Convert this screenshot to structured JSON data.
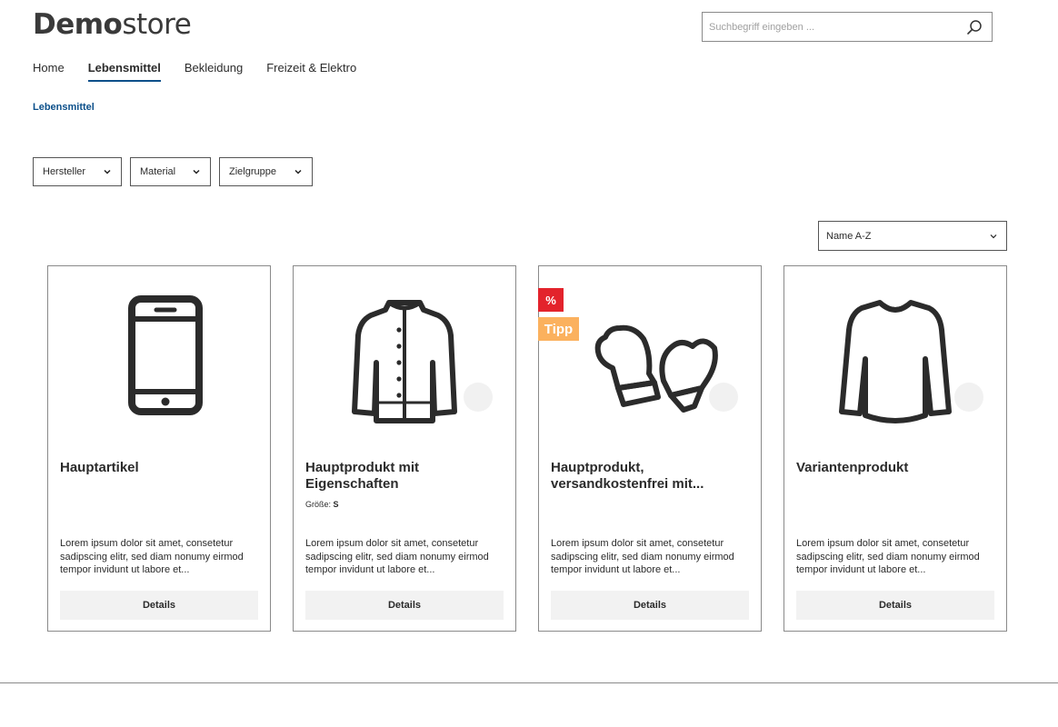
{
  "header": {
    "logo_bold": "Demo",
    "logo_light": "store",
    "search": {
      "placeholder": "Suchbegriff eingeben ..."
    }
  },
  "nav": {
    "items": [
      "Home",
      "Lebensmittel",
      "Bekleidung",
      "Freizeit & Elektro"
    ],
    "active": "Lebensmittel"
  },
  "breadcrumb": "Lebensmittel",
  "filters": [
    "Hersteller",
    "Material",
    "Zielgruppe"
  ],
  "sort": {
    "selected": "Name A-Z"
  },
  "products": [
    {
      "title": "Hauptartikel",
      "image": "smartphone-icon",
      "property_label": "",
      "property_value": "",
      "description": "Lorem ipsum dolor sit amet, consetetur sadipscing elitr, sed diam nonumy eirmod tempor invidunt ut labore et...",
      "button": "Details"
    },
    {
      "title": "Hauptprodukt mit Eigenschaften",
      "image": "jacket-icon",
      "property_label": "Größe: ",
      "property_value": "S",
      "description": "Lorem ipsum dolor sit amet, consetetur sadipscing elitr, sed diam nonumy eirmod tempor invidunt ut labore et...",
      "button": "Details"
    },
    {
      "title": "Hauptprodukt, versandkostenfrei mit...",
      "image": "mittens-icon",
      "badge_sale": "%",
      "badge_tip": "Tipp",
      "property_label": "",
      "property_value": "",
      "description": "Lorem ipsum dolor sit amet, consetetur sadipscing elitr, sed diam nonumy eirmod tempor invidunt ut labore et...",
      "button": "Details"
    },
    {
      "title": "Variantenprodukt",
      "image": "longsleeve-shirt-icon",
      "property_label": "",
      "property_value": "",
      "description": "Lorem ipsum dolor sit amet, consetetur sadipscing elitr, sed diam nonumy eirmod tempor invidunt ut labore et...",
      "button": "Details"
    }
  ],
  "colors": {
    "accent": "#0b4f8a",
    "sale_badge": "#e3232c",
    "tip_badge": "#fbb15e",
    "text": "#2b2b2b"
  }
}
